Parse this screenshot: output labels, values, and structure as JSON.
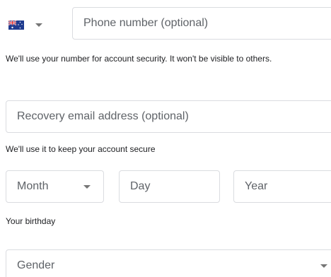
{
  "phone": {
    "placeholder": "Phone number (optional)",
    "hint": "We'll use your number for account security. It won't be visible to others."
  },
  "recovery": {
    "placeholder": "Recovery email address (optional)",
    "hint": "We'll use it to keep your account secure"
  },
  "birthday": {
    "month_label": "Month",
    "day_placeholder": "Day",
    "year_placeholder": "Year",
    "hint": "Your birthday"
  },
  "gender": {
    "label": "Gender"
  },
  "icons": {
    "country_flag": "flag-australia-icon",
    "dropdown": "chevron-down-icon"
  },
  "colors": {
    "border": "#dadce0",
    "placeholder": "#5f6368",
    "text": "#202124"
  }
}
